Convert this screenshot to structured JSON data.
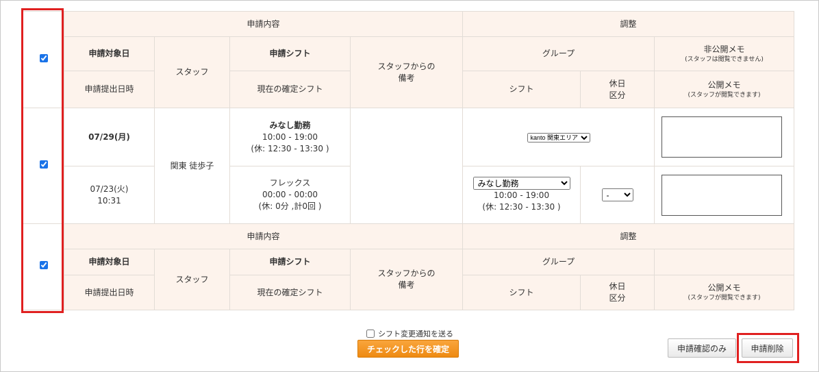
{
  "header": {
    "request_content": "申請内容",
    "adjustment": "調整",
    "request_date": "申請対象日",
    "staff": "スタッフ",
    "request_shift": "申請シフト",
    "staff_note_line1": "スタッフからの",
    "staff_note_line2": "備考",
    "group": "グループ",
    "private_memo": "非公開メモ",
    "private_memo_note": "(スタッフは閲覧できません)",
    "submitted_at": "申請提出日時",
    "current_shift": "現在の確定シフト",
    "shift": "シフト",
    "holiday_line1": "休日",
    "holiday_line2": "区分",
    "public_memo": "公開メモ",
    "public_memo_note": "(スタッフが閲覧できます)"
  },
  "row": {
    "target_date": "07/29(月)",
    "submitted_date": "07/23(火)",
    "submitted_time": "10:31",
    "staff_name": "関東 徒歩子",
    "req_shift_name": "みなし勤務",
    "req_shift_time": "10:00 - 19:00",
    "req_shift_break": "(休: 12:30 - 13:30 )",
    "cur_shift_name": "フレックス",
    "cur_shift_time": "00:00 - 00:00",
    "cur_shift_break": "(休: 0分 ,計0回 )",
    "group_select": "kanto 関東エリア",
    "shift_select": "みなし勤務",
    "adj_shift_time": "10:00 - 19:00",
    "adj_shift_break": "(休: 12:30 - 13:30 )",
    "holiday_select": "-"
  },
  "footer": {
    "notify_label": "シフト変更通知を送る",
    "confirm_button": "チェックした行を確定",
    "check_only_button": "申請確認のみ",
    "delete_button": "申請削除"
  },
  "colors": {
    "header_bg": "#fdf3ec",
    "accent_orange": "#ee8a12",
    "highlight_red": "#e02020"
  }
}
